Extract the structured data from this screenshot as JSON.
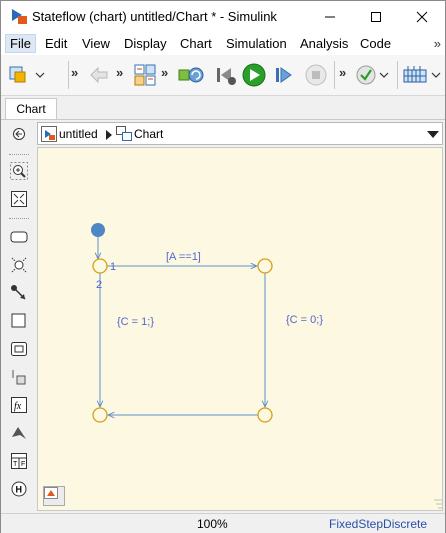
{
  "window": {
    "title": "Stateflow (chart) untitled/Chart * - Simulink"
  },
  "menu": {
    "items": [
      "File",
      "Edit",
      "View",
      "Display",
      "Chart",
      "Simulation",
      "Analysis",
      "Code"
    ],
    "more": "»"
  },
  "toolbar": {
    "more": "»"
  },
  "tabs": [
    "Chart"
  ],
  "breadcrumb": {
    "model": "untitled",
    "chart": "Chart"
  },
  "diagram": {
    "transition_top_label": "[A ==1]",
    "transition_left_label": "{C = 1;}",
    "transition_right_label": "{C = 0;}",
    "execution_order_1": "1",
    "execution_order_2": "2"
  },
  "status": {
    "zoom": "100%",
    "solver": "FixedStepDiscrete"
  },
  "colors": {
    "canvas": "#fdf8e2",
    "junction_stroke": "#d4a017",
    "default_transition_dot": "#4f86c6",
    "transition_line": "#5b8fc7",
    "label_text": "#5566cc"
  }
}
